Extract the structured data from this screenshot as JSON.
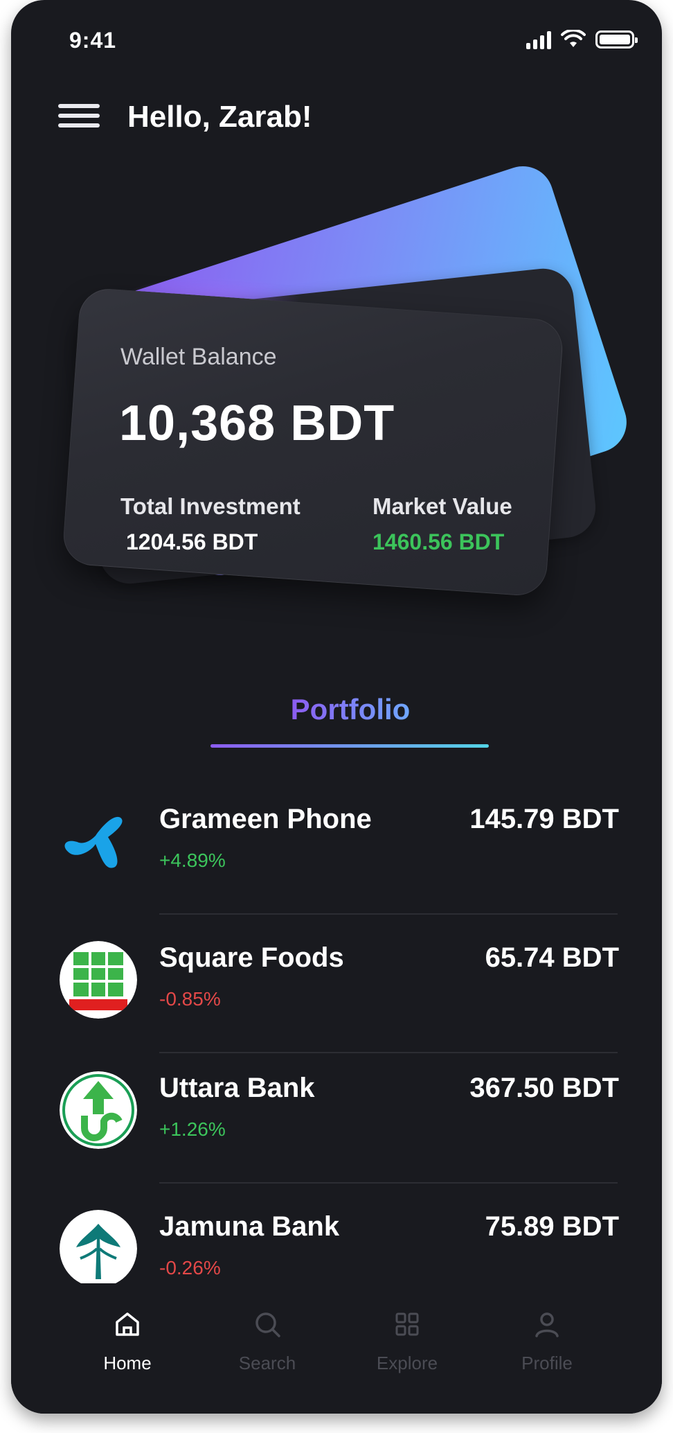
{
  "status_bar": {
    "time": "9:41"
  },
  "header": {
    "greeting": "Hello, Zarab!"
  },
  "wallet": {
    "label": "Wallet Balance",
    "amount": "10,368 BDT",
    "total_investment_label": "Total Investment",
    "total_investment_value": "1204.56 BDT",
    "market_value_label": "Market Value",
    "market_value_value": "1460.56 BDT"
  },
  "portfolio_tab": {
    "label": "Portfolio"
  },
  "stocks": [
    {
      "name": "Grameen Phone",
      "change": "+4.89%",
      "price": "145.79 BDT"
    },
    {
      "name": "Square Foods",
      "change": "-0.85%",
      "price": "65.74 BDT"
    },
    {
      "name": "Uttara Bank",
      "change": "+1.26%",
      "price": "367.50 BDT"
    },
    {
      "name": "Jamuna Bank",
      "change": "-0.26%",
      "price": "75.89 BDT"
    }
  ],
  "nav": [
    {
      "label": "Home",
      "icon": "home-icon",
      "active": true
    },
    {
      "label": "Search",
      "icon": "search-icon",
      "active": false
    },
    {
      "label": "Explore",
      "icon": "grid-icon",
      "active": false
    },
    {
      "label": "Profile",
      "icon": "user-icon",
      "active": false
    }
  ],
  "colors": {
    "background": "#191a1f",
    "positive": "#3cc45b",
    "negative": "#e34848",
    "accent_purple": "#8c5cf0",
    "accent_blue": "#5cc8ff",
    "nav_inactive": "#4b4c54"
  }
}
